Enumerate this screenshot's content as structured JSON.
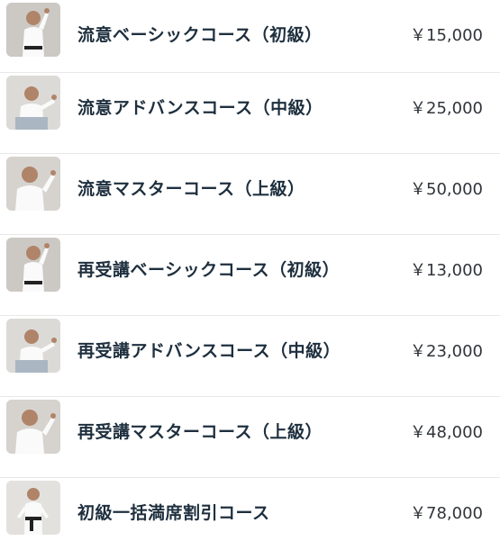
{
  "courses": [
    {
      "name": "流意ベーシックコース（初級）",
      "price": "￥15,000",
      "photo": "instructor-photo"
    },
    {
      "name": "流意アドバンスコース（中級）",
      "price": "￥25,000",
      "photo": "instructor-photo"
    },
    {
      "name": "流意マスターコース（上級）",
      "price": "￥50,000",
      "photo": "instructor-photo"
    },
    {
      "name": "再受講ベーシックコース（初級）",
      "price": "￥13,000",
      "photo": "instructor-photo"
    },
    {
      "name": "再受講アドバンスコース（中級）",
      "price": "￥23,000",
      "photo": "instructor-photo"
    },
    {
      "name": "再受講マスターコース（上級）",
      "price": "￥48,000",
      "photo": "instructor-photo"
    },
    {
      "name": "初級一括満席割引コース",
      "price": "￥78,000",
      "photo": "instructor-photo"
    }
  ],
  "colors": {
    "name_text": "#1e2f3e",
    "price_text": "#30343a",
    "divider": "#e8e8e8",
    "gi": "#ffffff",
    "photo_bg": "#d9d6d3"
  }
}
